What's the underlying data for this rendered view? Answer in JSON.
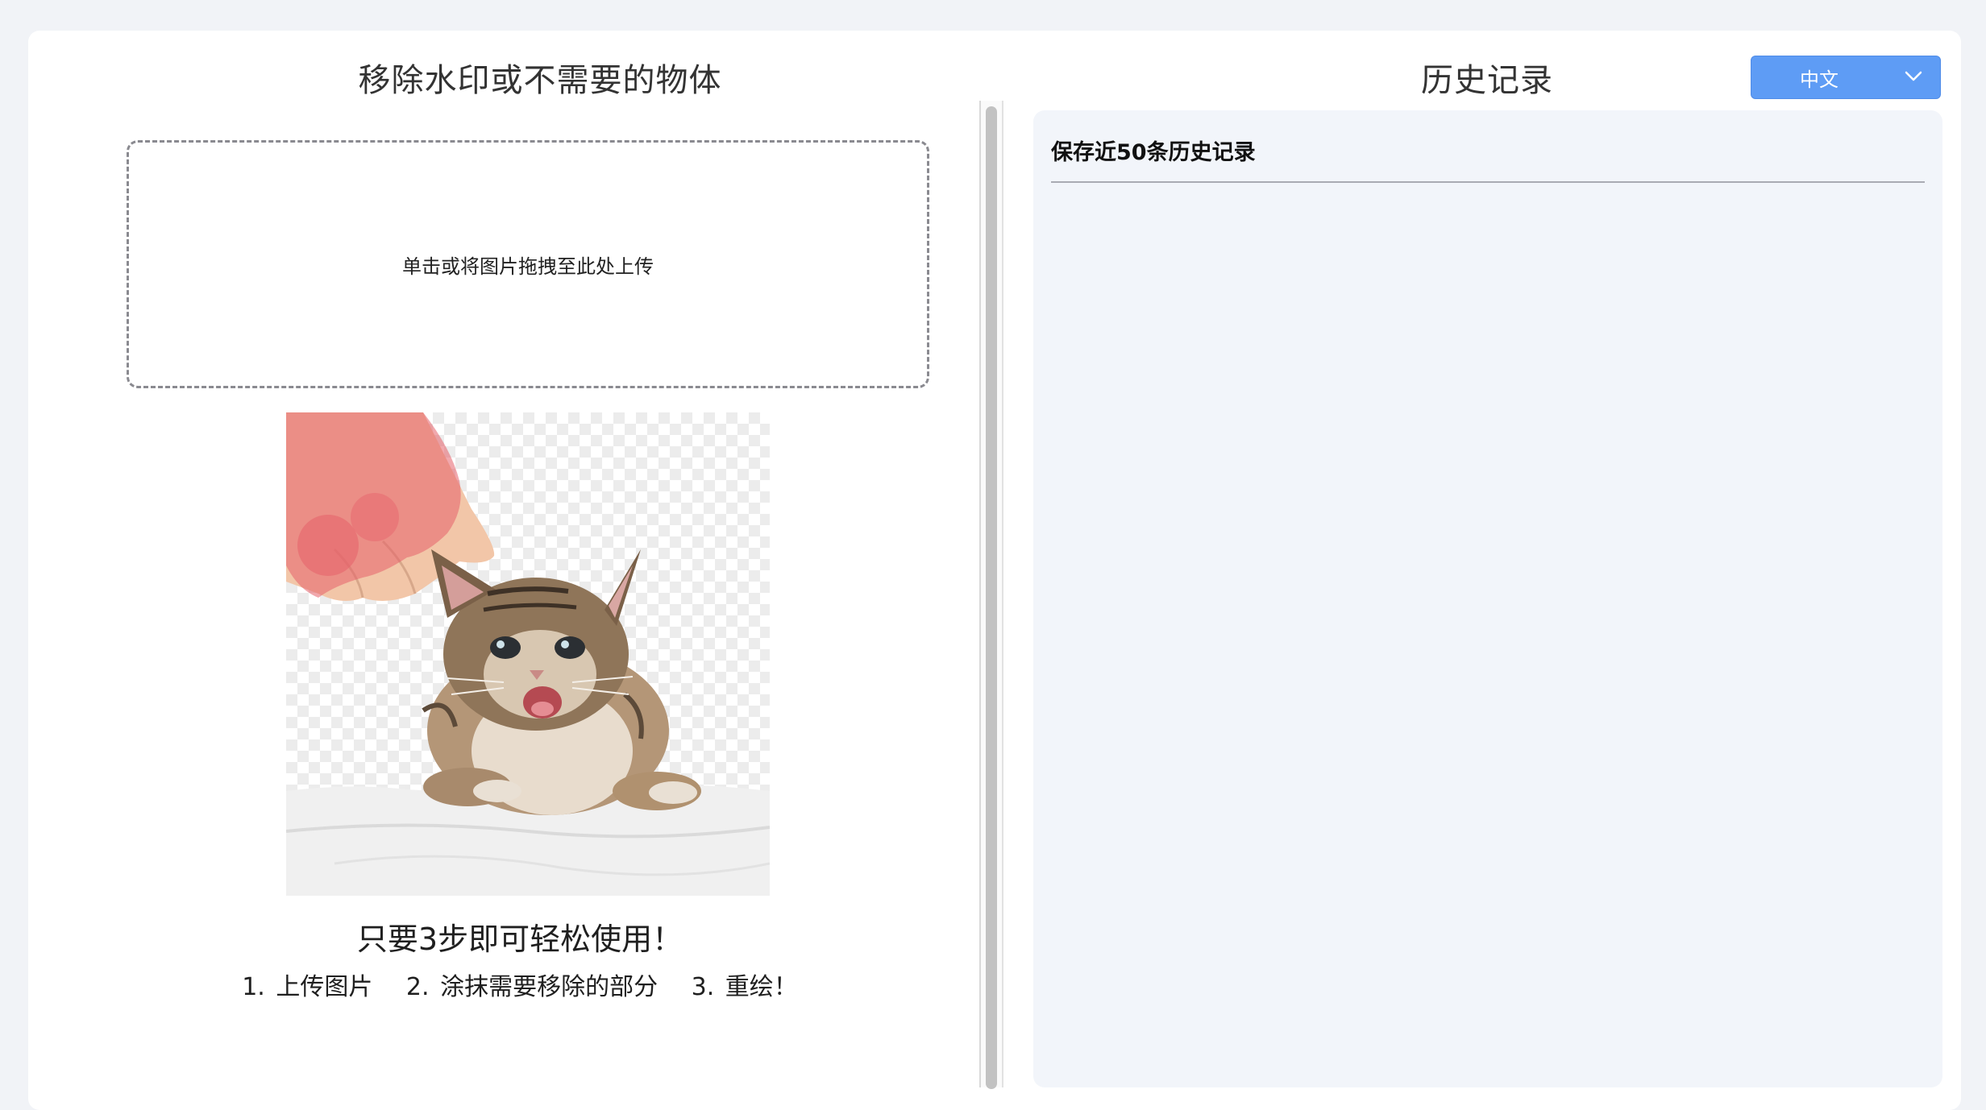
{
  "left": {
    "title": "移除水印或不需要的物体",
    "upload_prompt": "单击或将图片拖拽至此处上传",
    "steps_title": "只要3步即可轻松使用！",
    "steps": [
      "1. 上传图片",
      "2. 涂抹需要移除的部分",
      "3. 重绘！"
    ]
  },
  "right": {
    "title": "历史记录",
    "language_selected": "中文",
    "history_header": "保存近50条历史记录"
  },
  "colors": {
    "accent": "#5e9cf5",
    "panel_bg": "#f2f5fa",
    "page_bg": "#f1f3f7",
    "paint_mask": "#e6606a"
  },
  "icons": {
    "dropdown": "chevron-down-icon"
  }
}
